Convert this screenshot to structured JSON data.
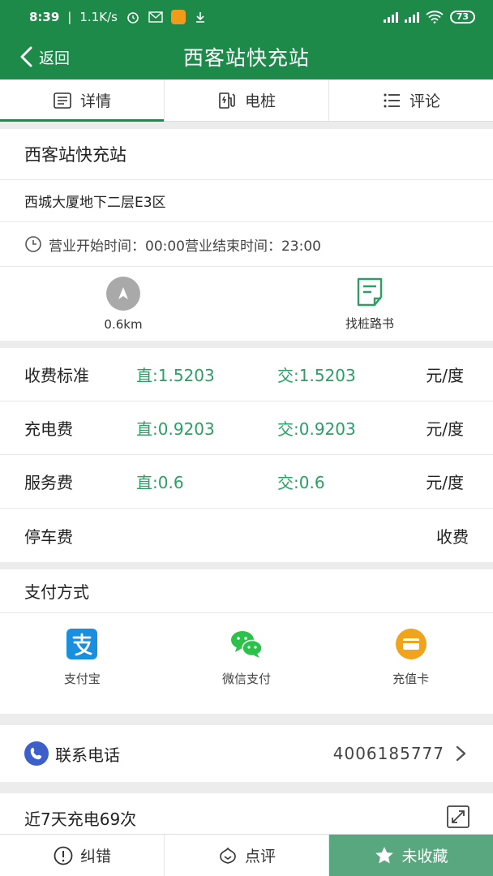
{
  "status": {
    "time": "8:39",
    "speed": "1.1K/s",
    "battery": "73"
  },
  "header": {
    "back_label": "返回",
    "title": "西客站快充站"
  },
  "tabs": [
    {
      "label": "详情"
    },
    {
      "label": "电桩"
    },
    {
      "label": "评论"
    }
  ],
  "station": {
    "name": "西客站快充站",
    "address": "西城大厦地下二层E3区",
    "hours": "营业开始时间：00:00营业结束时间：23:00"
  },
  "actions": {
    "distance": "0.6km",
    "guide_label": "找桩路书"
  },
  "fees": [
    {
      "label": "收费标准",
      "dc": "直:1.5203",
      "ac": "交:1.5203",
      "unit": "元/度"
    },
    {
      "label": "充电费",
      "dc": "直:0.9203",
      "ac": "交:0.9203",
      "unit": "元/度"
    },
    {
      "label": "服务费",
      "dc": "直:0.6",
      "ac": "交:0.6",
      "unit": "元/度"
    }
  ],
  "parking": {
    "label": "停车费",
    "value": "收费"
  },
  "payment": {
    "title": "支付方式",
    "options": [
      {
        "label": "支付宝"
      },
      {
        "label": "微信支付"
      },
      {
        "label": "充值卡"
      }
    ]
  },
  "contact": {
    "label": "联系电话",
    "number": "4006185777"
  },
  "stats": {
    "text": "近7天充电69次"
  },
  "bottom": {
    "report": "纠错",
    "review": "点评",
    "favorite": "未收藏"
  },
  "colors": {
    "primary": "#1e8a4a",
    "accent_text": "#2aa064",
    "favorite_bg": "#58a77e"
  }
}
